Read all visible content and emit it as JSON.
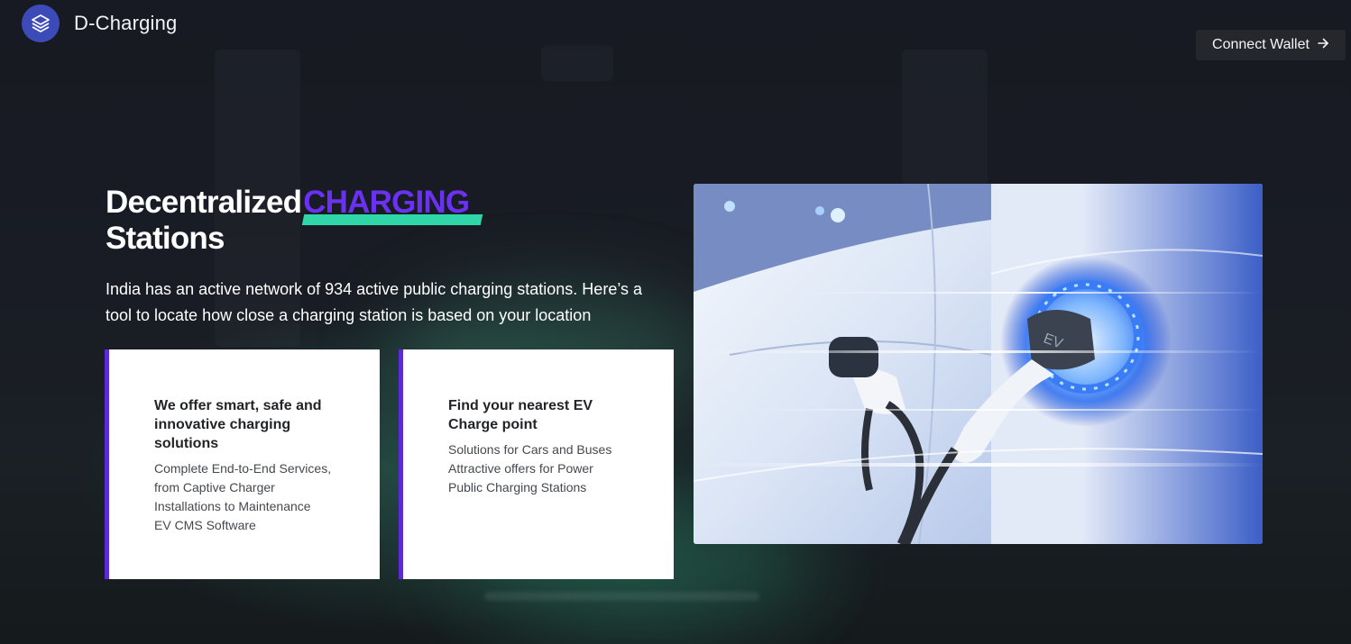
{
  "header": {
    "brand": "D-Charging",
    "logo_icon": "layers-icon",
    "connect_label": "Connect Wallet",
    "connect_icon": "arrow-right-icon"
  },
  "hero": {
    "title_prefix": "Decentralized",
    "title_highlight": "CHARGING",
    "title_suffix": "Stations",
    "description": "India has an active network of 934 active public charging stations. Here’s a tool to locate how close a charging station is based on your location",
    "image_subject": "ev-charging-plug-image"
  },
  "cards": [
    {
      "title": "We offer smart, safe and innovative charging solutions",
      "lines": [
        "Complete End-to-End Services,",
        "from Captive Charger",
        "Installations to Maintenance",
        "EV CMS Software"
      ]
    },
    {
      "title": "Find your nearest EV Charge point",
      "lines": [
        "Solutions for Cars and Buses",
        "Attractive offers for Power",
        "Public Charging Stations"
      ]
    }
  ],
  "colors": {
    "background": "#15171d",
    "logo": "#3c4bb8",
    "highlight_text": "#6a32f0",
    "highlight_bar": "#2fd6a8",
    "card_accent": "#5b2ad9",
    "button_bg": "#25272c"
  }
}
